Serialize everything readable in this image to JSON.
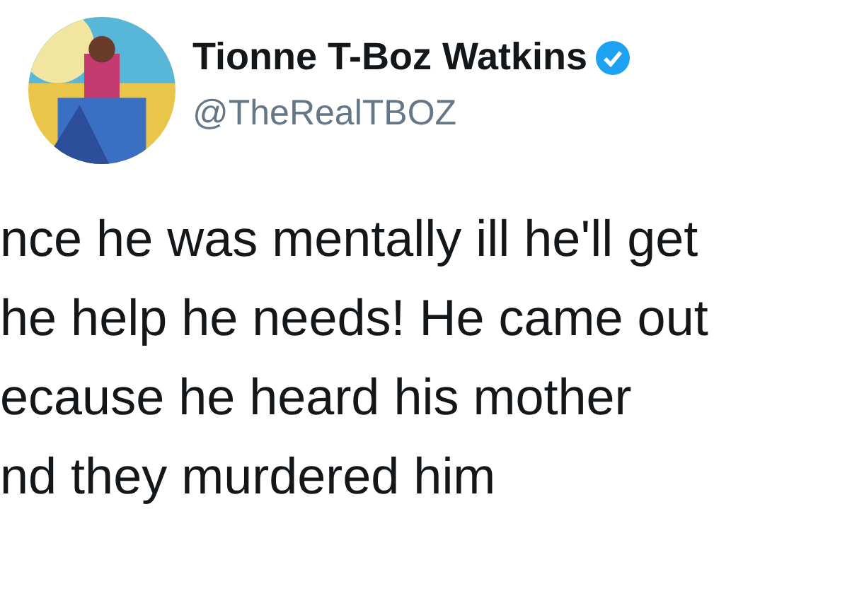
{
  "author": {
    "name": "Tionne T-Boz Watkins",
    "verified": true,
    "handle": "@TheRealTBOZ"
  },
  "tweet_lines": [
    "nce he was mentally ill he'll get",
    "he help he needs! He came out",
    "ecause he heard his mother",
    "nd they murdered him"
  ]
}
